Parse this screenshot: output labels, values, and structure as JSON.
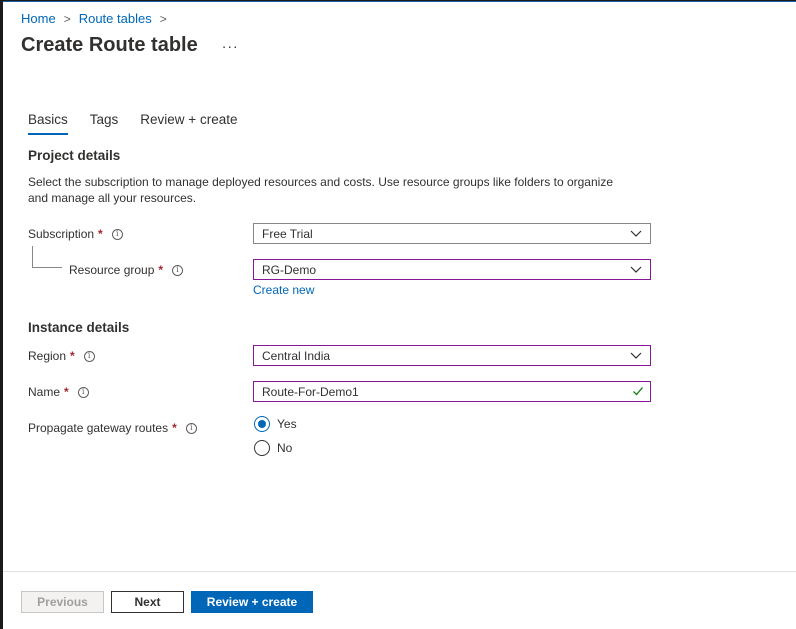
{
  "breadcrumb": {
    "home": "Home",
    "route_tables": "Route tables",
    "separator": ">"
  },
  "page": {
    "title": "Create Route table",
    "more": "···"
  },
  "tabs": [
    {
      "label": "Basics",
      "active": true
    },
    {
      "label": "Tags",
      "active": false
    },
    {
      "label": "Review + create",
      "active": false
    }
  ],
  "project_details": {
    "title": "Project details",
    "description": "Select the subscription to manage deployed resources and costs. Use resource groups like folders to organize and manage all your resources.",
    "subscription": {
      "label": "Subscription",
      "value": "Free Trial"
    },
    "resource_group": {
      "label": "Resource group",
      "value": "RG-Demo",
      "create_new": "Create new"
    }
  },
  "instance_details": {
    "title": "Instance details",
    "region": {
      "label": "Region",
      "value": "Central India"
    },
    "name": {
      "label": "Name",
      "value": "Route-For-Demo1",
      "valid": true
    },
    "propagate": {
      "label": "Propagate gateway routes",
      "options": [
        {
          "label": "Yes",
          "checked": true
        },
        {
          "label": "No",
          "checked": false
        }
      ]
    }
  },
  "required_marker": "*",
  "info_glyph": "i",
  "footer": {
    "previous": "Previous",
    "next": "Next",
    "review_create": "Review + create"
  },
  "colors": {
    "accent": "#0067b8",
    "required": "#a4262c",
    "focus_border": "#881798",
    "valid": "#107c10"
  }
}
